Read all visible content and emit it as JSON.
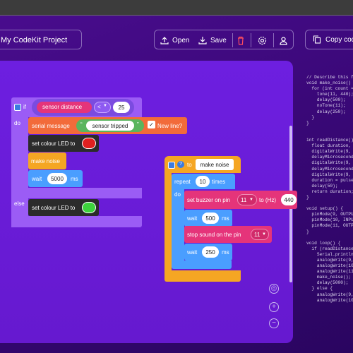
{
  "header": {
    "project_name": "My CodeKit Project",
    "open_label": "Open",
    "save_label": "Save",
    "copy_label": "Copy code"
  },
  "icons": [
    "open-icon",
    "save-icon",
    "delete-icon",
    "settings-icon",
    "user-icon",
    "copy-icon",
    "locate-icon",
    "zoom-in-icon",
    "zoom-out-icon"
  ],
  "colors": {
    "background": "#3a0878",
    "workspace": "#6a1fd6",
    "control_block": "#9b5cf5",
    "serial_block": "#f26b3a",
    "led_block": "#2b2b2b",
    "sound_block": "#f5a623",
    "wait_block": "#4a9eff",
    "buzzer_block": "#e5347a",
    "logic_block": "#5ab55e",
    "text_block": "#ffffff"
  },
  "blocks": {
    "if_block": {
      "if_label": "if",
      "sensor_label": "sensor distance",
      "operator": "<",
      "threshold": "25",
      "do_label": "do",
      "serial_label": "serial message",
      "quote_open": "“",
      "serial_text": "sensor tripped",
      "quote_close": "”",
      "newline_label": "New line?",
      "checkmark": "✓",
      "led_label_1": "set colour LED to",
      "make_noise_label": "make noise",
      "wait_label": "wait",
      "wait_value": "5000",
      "wait_unit": "ms",
      "else_label": "else",
      "led_label_2": "set colour LED to",
      "led_color_1": "#e02020",
      "led_color_2": "#3dd23d"
    },
    "function_block": {
      "to_label": "to",
      "name": "make noise",
      "repeat_label": "repeat",
      "repeat_value": "10",
      "times_label": "times",
      "do_label": "do",
      "buzzer_label": "set buzzer on pin",
      "pin_value": "11",
      "hz_label": "to (Hz)",
      "hz_value": "440",
      "wait_label_1": "wait",
      "wait_value_1": "500",
      "wait_unit": "ms",
      "stop_label": "stop sound on the pin",
      "stop_pin": "11",
      "wait_label_2": "wait",
      "wait_value_2": "250"
    }
  },
  "code_lines": [
    "// Describe this f",
    "void make_noise()",
    "  for (int count =",
    "    tone(11, 440);",
    "    delay(500);",
    "    noTone(11);",
    "    delay(250);",
    "  }",
    "}",
    "",
    "",
    "int readDistance()",
    "  float duration,",
    "  digitalWrite(9,",
    "  delayMicrosecond",
    "  digitalWrite(9,",
    "  delayMicrosecond",
    "  digitalWrite(9,",
    "  duration = pulse",
    "  delay(50);",
    "  return duration;",
    "}",
    "",
    "void setup() {",
    "  pinMode(9, OUTPU",
    "  pinMode(10, INPU",
    "  pinMode(11, OUTP",
    "}",
    "",
    "void loop() {",
    "  if (readDistance",
    "    Serial.println",
    "    analogWrite(9,",
    "    analogWrite(10",
    "    analogWrite(11",
    "    make_noise();",
    "    delay(5000);",
    "  } else {",
    "    analogWrite(9,",
    "    analogWrite(10"
  ]
}
